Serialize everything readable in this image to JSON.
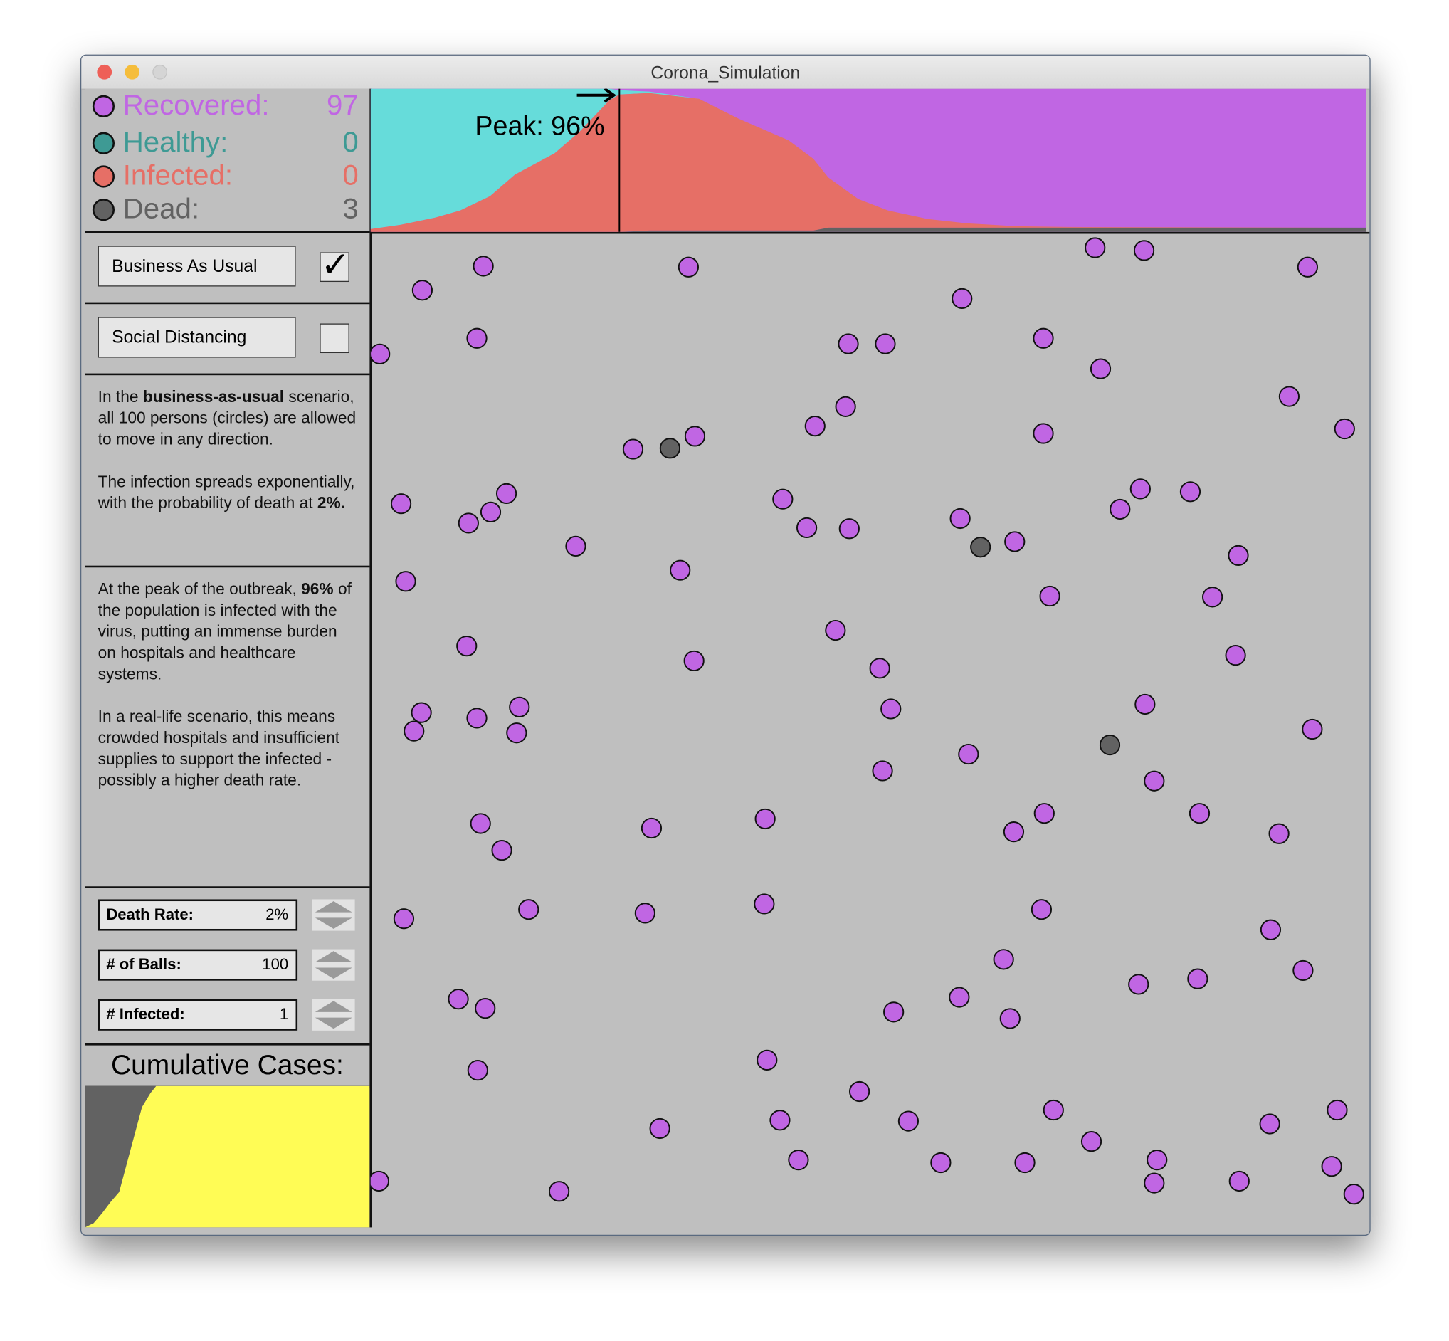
{
  "window": {
    "title": "Corona_Simulation"
  },
  "stats": [
    {
      "label": "Recovered:",
      "value": "97",
      "color": "#c066e3"
    },
    {
      "label": "Healthy:",
      "value": "0",
      "color": "#3e9a94"
    },
    {
      "label": "Infected:",
      "value": "0",
      "color": "#e66f66"
    },
    {
      "label": "Dead:",
      "value": "3",
      "color": "#626262"
    }
  ],
  "scenarios": [
    {
      "label": "Business As Usual",
      "checked": true,
      "check_glyph": "✓"
    },
    {
      "label": "Social Distancing",
      "checked": false
    }
  ],
  "description1": [
    [
      {
        "t": "In the "
      },
      {
        "t": "business-as-usual",
        "b": true
      },
      {
        "t": " scenario, all 100 persons (circles) are allowed to move in any direction."
      }
    ],
    [
      {
        "t": "The infection spreads exponentially, with the probability of death at "
      },
      {
        "t": "2%.",
        "b": true
      }
    ]
  ],
  "description2": [
    [
      {
        "t": "At the peak of the outbreak, "
      },
      {
        "t": "96%",
        "b": true
      },
      {
        "t": " of the population is infected with the virus, putting an immense burden on hospitals and healthcare systems."
      }
    ],
    [
      {
        "t": "In a real-life scenario, this means crowded hospitals and insufficient supplies to support the infected - possibly a higher death rate."
      }
    ]
  ],
  "params": [
    {
      "label": "Death Rate:",
      "value": "2%"
    },
    {
      "label": "# of Balls:",
      "value": "100"
    },
    {
      "label": "# Infected:",
      "value": "1"
    }
  ],
  "cumulative": {
    "title": "Cumulative Cases:"
  },
  "colors": {
    "recovered": "#c066e3",
    "healthy": "#66dcda",
    "infected": "#e66f66",
    "dead": "#626262",
    "cumulative": "#fffc55",
    "bg": "#bfbfbf"
  },
  "chart_data": [
    {
      "type": "area",
      "title": "Population status over time",
      "annotation": "Peak: 96%",
      "peak_time_pct": 25,
      "x": [
        0,
        3,
        6.5,
        9,
        12,
        14.5,
        18.5,
        21,
        24,
        25,
        28,
        33,
        35,
        37,
        42,
        44.5,
        46,
        49,
        52,
        56,
        60,
        65,
        70,
        100
      ],
      "series": [
        {
          "name": "Infected",
          "values": [
            2,
            5,
            10,
            15,
            25,
            40,
            55,
            70,
            92,
            96,
            96,
            92,
            85,
            78,
            63,
            50,
            35,
            20,
            12,
            6,
            3,
            1,
            0.5,
            0
          ]
        },
        {
          "name": "Dead",
          "values": [
            0,
            0,
            0,
            0,
            0,
            0,
            0,
            0,
            0,
            0,
            1,
            1,
            1,
            1,
            1,
            1,
            3,
            3,
            3,
            3,
            3,
            3,
            3,
            3
          ]
        },
        {
          "name": "Healthy",
          "values": [
            98,
            95,
            90,
            85,
            75,
            60,
            45,
            30,
            8,
            3,
            1,
            0,
            0,
            0,
            0,
            0,
            0,
            0,
            0,
            0,
            0,
            0,
            0,
            0
          ]
        }
      ],
      "ylim": [
        0,
        100
      ]
    },
    {
      "type": "area",
      "title": "Cumulative Cases:",
      "x": [
        0,
        3,
        6,
        9,
        12,
        14,
        16,
        18,
        20,
        23,
        25,
        100
      ],
      "values": [
        0,
        3,
        10,
        18,
        25,
        40,
        55,
        70,
        85,
        95,
        100,
        100
      ],
      "ylim": [
        0,
        100
      ]
    }
  ]
}
